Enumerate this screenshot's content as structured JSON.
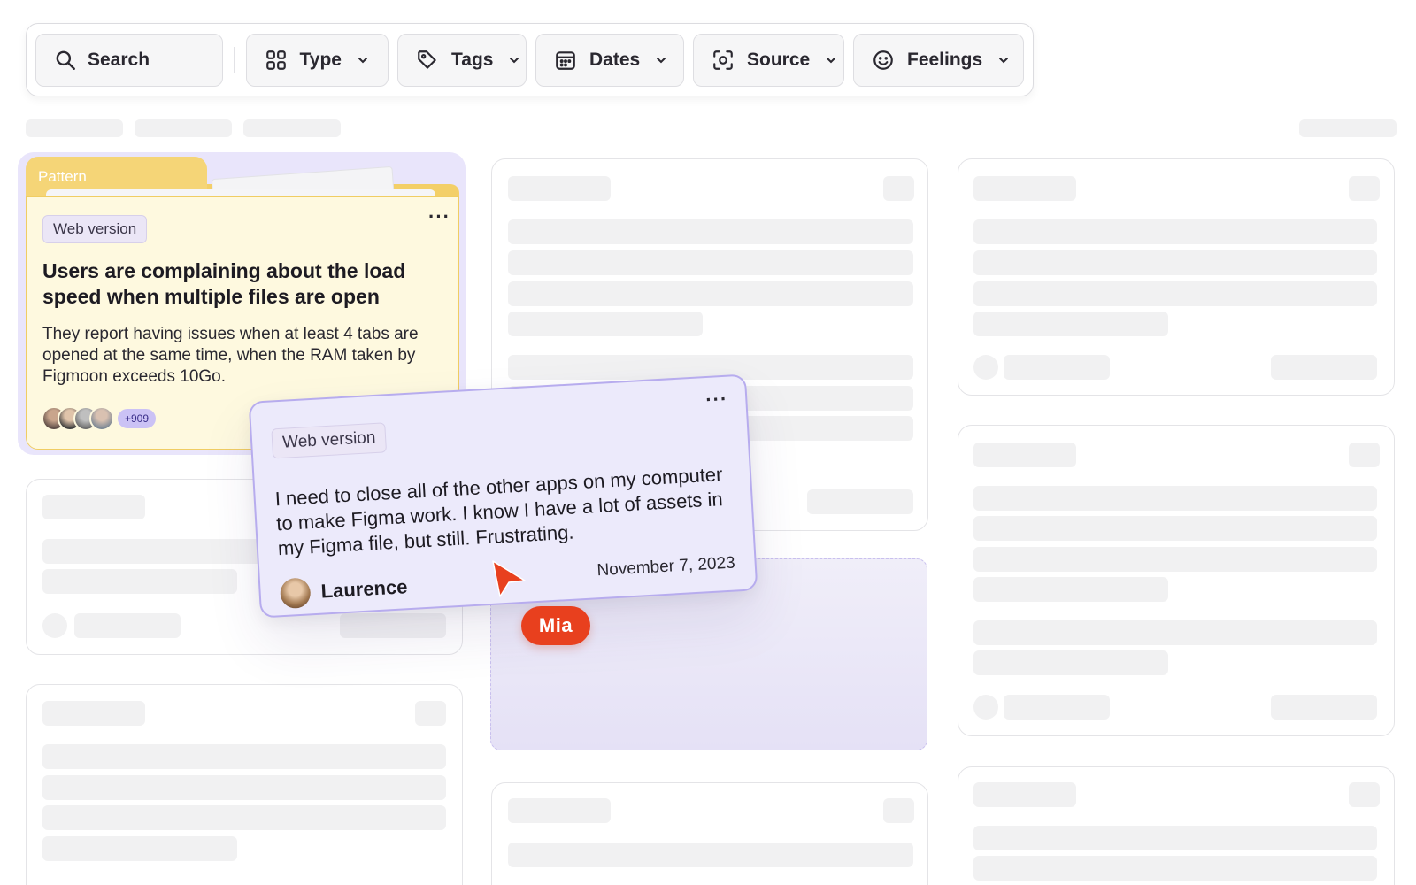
{
  "filters": {
    "search_label": "Search",
    "type_label": "Type",
    "tags_label": "Tags",
    "dates_label": "Dates",
    "source_label": "Source",
    "feelings_label": "Feelings"
  },
  "pattern_card": {
    "folder_label": "Pattern",
    "badge": "Web version",
    "title": "Users are complaining about the load speed when multiple files are open",
    "description": "They report having issues when at least 4 tabs are opened at the same time, when the RAM taken by Figmoon exceeds 10Go.",
    "more_count": "+909",
    "menu": "···"
  },
  "quote_card": {
    "badge": "Web version",
    "text": "I need to close all of the other apps on my computer to make Figma work. I know I have a lot of assets in my Figma file, but still. Frustrating.",
    "author": "Laurence",
    "date": "November 7, 2023",
    "menu": "···"
  },
  "collaborator": {
    "name": "Mia",
    "color": "#e8401e"
  },
  "colors": {
    "pattern_bg": "#fef9df",
    "pattern_folder": "#f5d577",
    "quote_bg": "#eceafb",
    "quote_border": "#b7acee",
    "skeleton": "#f1f1f2"
  }
}
